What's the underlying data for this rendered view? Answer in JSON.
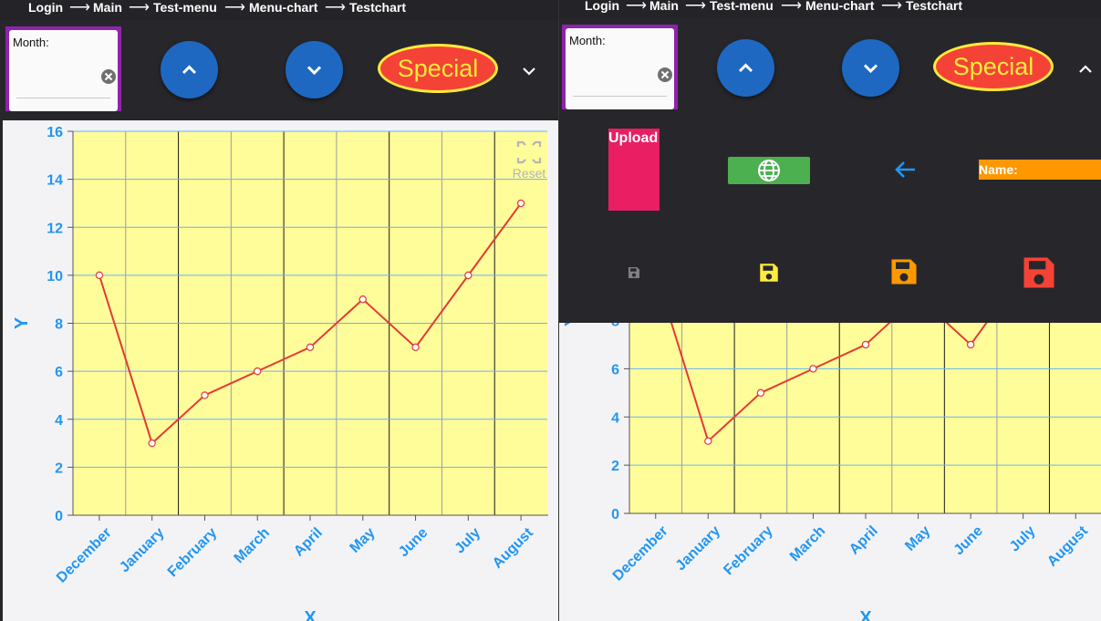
{
  "breadcrumb": {
    "items": [
      "Login",
      "Main",
      "Test-menu",
      "Menu-chart",
      "Testchart"
    ],
    "separator": "⟶"
  },
  "toolbar": {
    "month_label": "Month:",
    "special_label": "Special",
    "up_icon": "chevron-up-icon",
    "down_icon": "chevron-down-icon",
    "clear_icon": "clear-icon"
  },
  "menu_panel": {
    "upload_label": "Upload",
    "name_label": "Name:",
    "web_icon": "globe-icon",
    "back_icon": "arrow-left-icon",
    "save_icons": [
      {
        "name": "save-icon-small",
        "color": "#808080"
      },
      {
        "name": "save-icon-medium",
        "color": "#ffeb3b"
      },
      {
        "name": "save-icon-large",
        "color": "#ff9800"
      },
      {
        "name": "save-icon-xlarge",
        "color": "#f44336"
      }
    ],
    "panel_state": [
      "collapsed",
      "expanded"
    ]
  },
  "chart_reset_label": "Reset",
  "colors": {
    "accent_blue": "#1e68c2",
    "special_bg": "#f44336",
    "special_text": "#ffeb3b",
    "month_border": "#8e24aa",
    "upload_bg": "#e91e63",
    "web_bg": "#4caf50",
    "name_bg": "#ff9800",
    "plot_bg": "#fffc9a",
    "line": "#e53935",
    "axis_text": "#2196f3"
  },
  "chart_data": {
    "type": "line",
    "categories": [
      "December",
      "January",
      "February",
      "March",
      "April",
      "May",
      "June",
      "July",
      "August"
    ],
    "values": [
      10,
      3,
      5,
      6,
      7,
      9,
      7,
      10,
      13
    ],
    "xlabel": "X",
    "ylabel": "Y",
    "ylim": [
      0,
      16
    ],
    "yticks": [
      0,
      2,
      4,
      6,
      8,
      10,
      12,
      14,
      16
    ],
    "grid": true
  }
}
